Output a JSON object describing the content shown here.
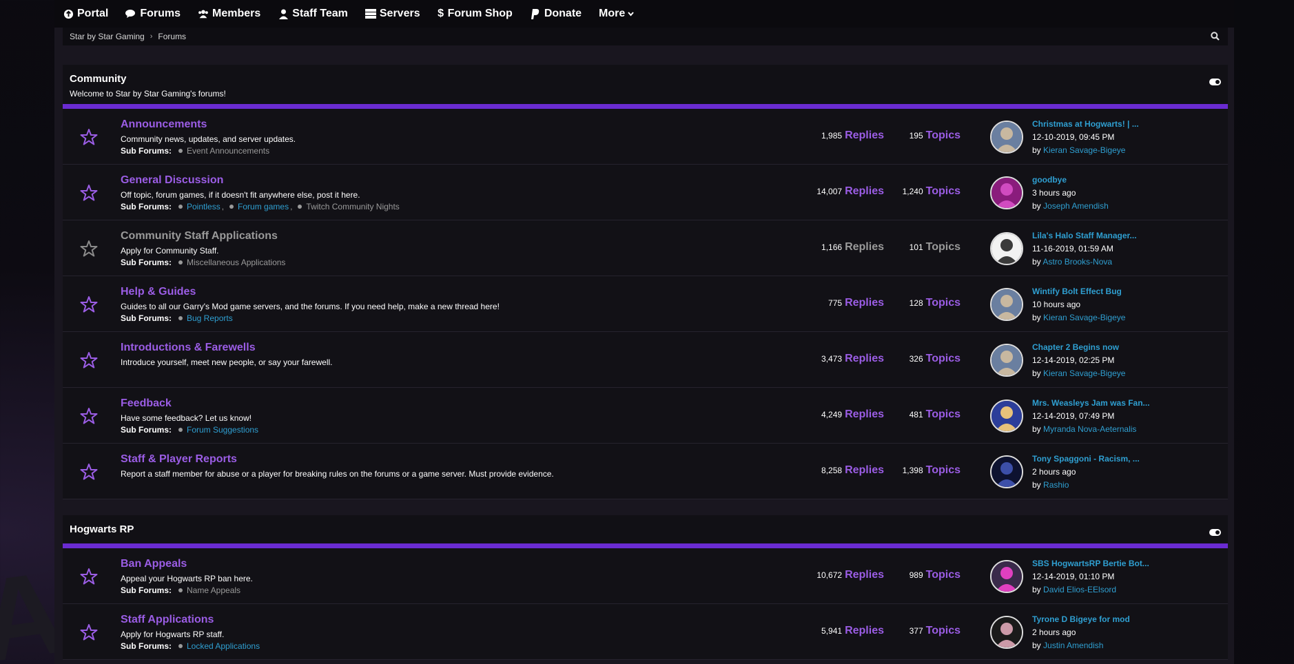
{
  "nav": {
    "portal": "Portal",
    "forums": "Forums",
    "members": "Members",
    "staff": "Staff Team",
    "servers": "Servers",
    "shop": "Forum Shop",
    "donate": "Donate",
    "more": "More"
  },
  "breadcrumb": {
    "home": "Star by Star Gaming",
    "current": "Forums"
  },
  "sections": [
    {
      "title": "Community",
      "description": "Welcome to Star by Star Gaming's forums!",
      "forums": [
        {
          "name": "Announcements",
          "desc": "Community news, updates, and server updates.",
          "sub_label": "Sub Forums:",
          "subs": [
            "Event Announcements"
          ],
          "replies": "1,985",
          "topics": "195",
          "replies_label": "Replies",
          "topics_label": "Topics",
          "last_title": "Christmas at Hogwarts! | ...",
          "last_date": "12-10-2019, 09:45 PM",
          "by": "by",
          "last_user": "Kieran Savage-Bigeye"
        },
        {
          "name": "General Discussion",
          "desc": "Off topic, forum games, if it doesn't fit anywhere else, post it here.",
          "sub_label": "Sub Forums:",
          "subs": [
            "Pointless",
            "Forum games",
            "Twitch Community Nights"
          ],
          "replies": "14,007",
          "topics": "1,240",
          "replies_label": "Replies",
          "topics_label": "Topics",
          "last_title": "goodbye",
          "last_date": "3 hours ago",
          "by": "by",
          "last_user": "Joseph Amendish"
        },
        {
          "name": "Community Staff Applications",
          "desc": "Apply for Community Staff.",
          "sub_label": "Sub Forums:",
          "subs": [
            "Miscellaneous Applications"
          ],
          "replies": "1,166",
          "topics": "101",
          "replies_label": "Replies",
          "topics_label": "Topics",
          "last_title": "Lila's Halo Staff Manager...",
          "last_date": "11-16-2019, 01:59 AM",
          "by": "by",
          "last_user": "Astro Brooks-Nova"
        },
        {
          "name": "Help & Guides",
          "desc": "Guides to all our Garry's Mod game servers, and the forums. If you need help, make a new thread here!",
          "sub_label": "Sub Forums:",
          "subs": [
            "Bug Reports"
          ],
          "replies": "775",
          "topics": "128",
          "replies_label": "Replies",
          "topics_label": "Topics",
          "last_title": "Wintify Bolt Effect Bug",
          "last_date": "10 hours ago",
          "by": "by",
          "last_user": "Kieran Savage-Bigeye"
        },
        {
          "name": "Introductions & Farewells",
          "desc": "Introduce yourself, meet new people, or say your farewell.",
          "sub_label": "",
          "subs": [],
          "replies": "3,473",
          "topics": "326",
          "replies_label": "Replies",
          "topics_label": "Topics",
          "last_title": "Chapter 2 Begins now",
          "last_date": "12-14-2019, 02:25 PM",
          "by": "by",
          "last_user": "Kieran Savage-Bigeye"
        },
        {
          "name": "Feedback",
          "desc": "Have some feedback? Let us know!",
          "sub_label": "Sub Forums:",
          "subs": [
            "Forum Suggestions"
          ],
          "replies": "4,249",
          "topics": "481",
          "replies_label": "Replies",
          "topics_label": "Topics",
          "last_title": "Mrs. Weasleys Jam was Fan...",
          "last_date": "12-14-2019, 07:49 PM",
          "by": "by",
          "last_user": "Myranda Nova-Aeternalis"
        },
        {
          "name": "Staff & Player Reports",
          "desc": "Report a staff member for abuse or a player for breaking rules on the forums or a game server. Must provide evidence.",
          "sub_label": "",
          "subs": [],
          "replies": "8,258",
          "topics": "1,398",
          "replies_label": "Replies",
          "topics_label": "Topics",
          "last_title": "Tony Spaggoni - Racism, ...",
          "last_date": "2 hours ago",
          "by": "by",
          "last_user": "Rashio"
        }
      ]
    },
    {
      "title": "Hogwarts RP",
      "description": "",
      "forums": [
        {
          "name": "Ban Appeals",
          "desc": "Appeal your Hogwarts RP ban here.",
          "sub_label": "Sub Forums:",
          "subs": [
            "Name Appeals"
          ],
          "replies": "10,672",
          "topics": "989",
          "replies_label": "Replies",
          "topics_label": "Topics",
          "last_title": "SBS HogwartsRP Bertie Bot...",
          "last_date": "12-14-2019, 01:10 PM",
          "by": "by",
          "last_user": "David Elios-EElsord"
        },
        {
          "name": "Staff Applications",
          "desc": "Apply for Hogwarts RP staff.",
          "sub_label": "Sub Forums:",
          "subs": [
            "Locked Applications"
          ],
          "replies": "5,941",
          "topics": "377",
          "replies_label": "Replies",
          "topics_label": "Topics",
          "last_title": "Tyrone D Bigeye for mod",
          "last_date": "2 hours ago",
          "by": "by",
          "last_user": "Justin Amendish"
        }
      ]
    }
  ],
  "colors": {
    "accent": "#9b5de5",
    "link": "#2f9fd1",
    "bar": "#6a2bd1",
    "muted": "#9a9a9a"
  }
}
